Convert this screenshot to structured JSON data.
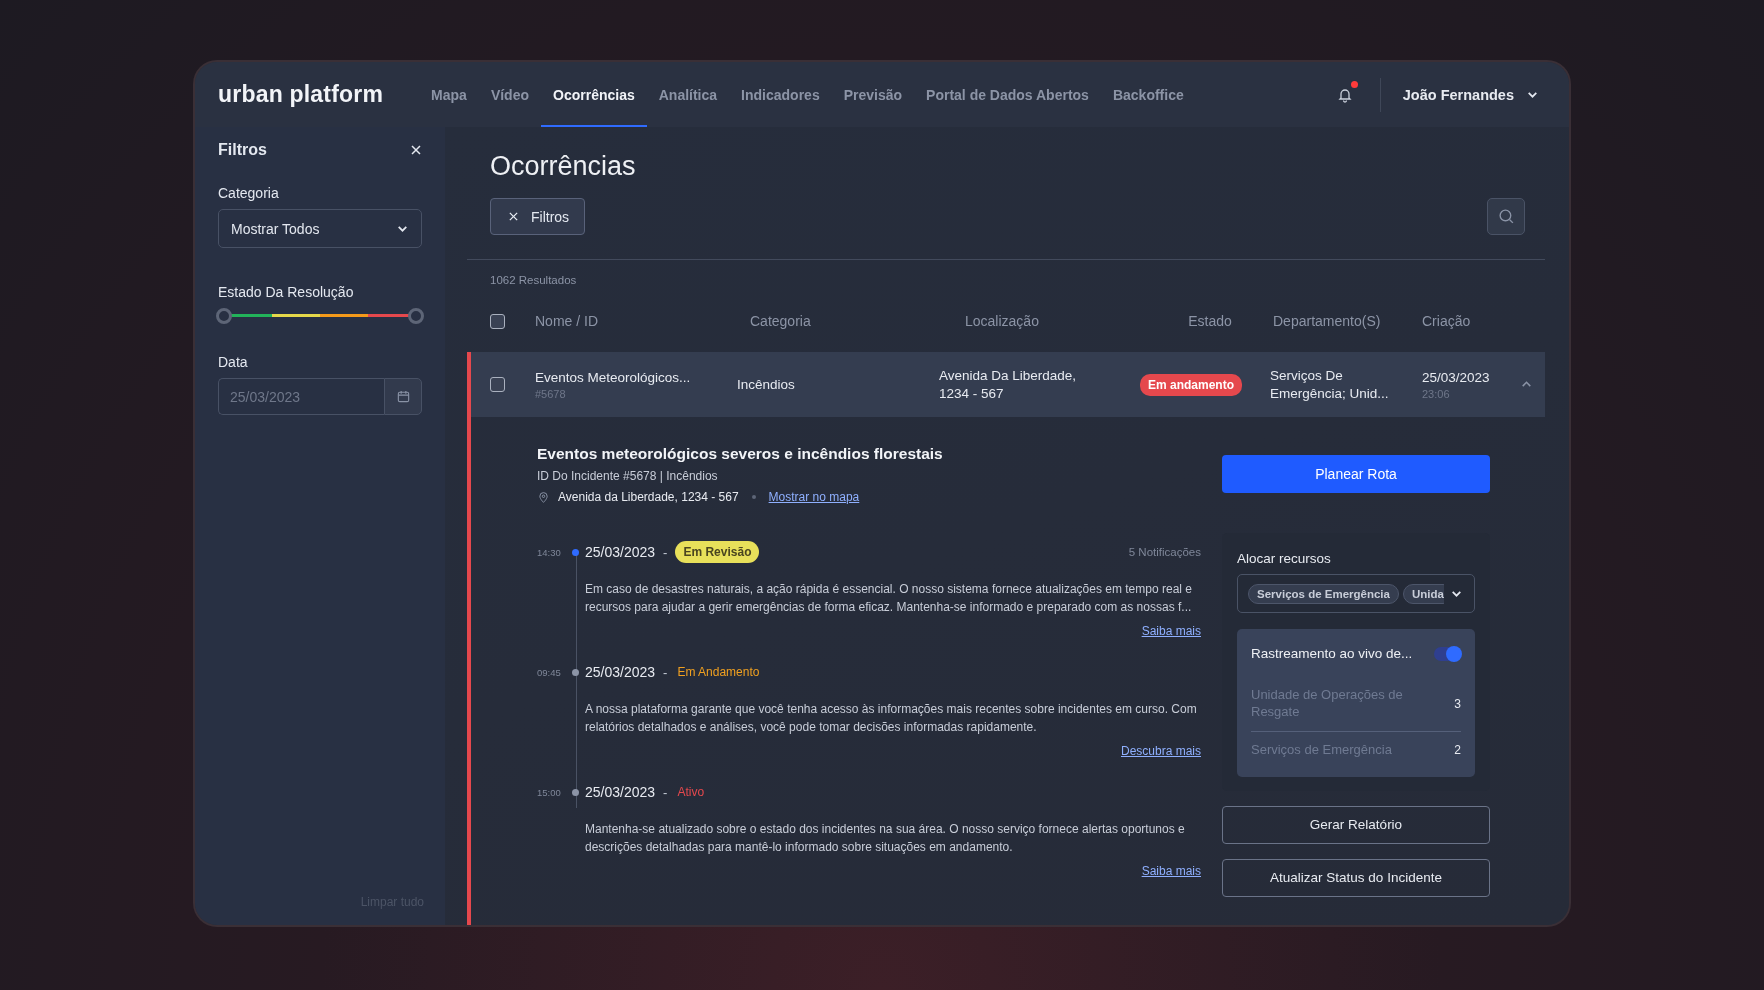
{
  "app": {
    "logo": "urban platform"
  },
  "nav": [
    {
      "label": "Mapa",
      "selected": false
    },
    {
      "label": "Vídeo",
      "selected": false
    },
    {
      "label": "Ocorrências",
      "selected": true
    },
    {
      "label": "Analítica",
      "selected": false
    },
    {
      "label": "Indicadores",
      "selected": false
    },
    {
      "label": "Previsão",
      "selected": false
    },
    {
      "label": "Portal de Dados Abertos",
      "selected": false
    },
    {
      "label": "Backoffice",
      "selected": false
    }
  ],
  "notifications": {
    "unread": true
  },
  "user": {
    "name": "João Fernandes"
  },
  "filters": {
    "title": "Filtros",
    "category_label": "Categoria",
    "category_value": "Mostrar Todos",
    "resolution_label": "Estado Da Resolução",
    "resolution_range": [
      {
        "level": 0
      },
      {
        "level": 1
      }
    ],
    "date_label": "Data",
    "date_placeholder": "25/03/2023",
    "clear": "Limpar tudo"
  },
  "page": {
    "title": "Ocorrências",
    "filters_button": "Filtros",
    "results": "1062 Resultados"
  },
  "table": {
    "select_all": {
      "checked": false
    },
    "columns": [
      "Nome / ID",
      "Categoria",
      "Localização",
      "Estado",
      "Departamento(S)",
      "Criação"
    ],
    "rows": [
      {
        "checked": false,
        "expanded": true,
        "name": "Eventos Meteorológicos...",
        "id": "#5678",
        "category": "Incêndios",
        "location": "Avenida Da Liberdade, 1234 - 567",
        "status": "Em andamento",
        "department": "Serviços De Emergência; Unid...",
        "date": "25/03/2023",
        "time": "23:06"
      }
    ]
  },
  "detail": {
    "title": "Eventos meteorológicos severos e incêndios florestais",
    "subtitle": "ID Do Incidente #5678 | Incêndios",
    "address": "Avenida da Liberdade, 1234 - 567",
    "map_link": "Mostrar no mapa",
    "timeline": [
      {
        "time": "14:30",
        "date": "25/03/2023",
        "separator": "-",
        "active": true,
        "status": {
          "kind": "badge",
          "label": "Em Revisão",
          "color": "#e8e05a"
        },
        "notifications": "5 Notificações",
        "text": "Em caso de desastres naturais, a ação rápida é essencial. O nosso sistema fornece atualizações em tempo real e recursos para ajudar a gerir emergências de forma eficaz. Mantenha-se informado e preparado com as nossas f...",
        "link": "Saiba mais"
      },
      {
        "time": "09:45",
        "date": "25/03/2023",
        "separator": "-",
        "active": false,
        "status": {
          "kind": "text",
          "label": "Em Andamento",
          "color": "#f0a020"
        },
        "text": "A nossa plataforma garante que você tenha acesso às informações mais recentes sobre incidentes em curso. Com relatórios detalhados e análises, você pode tomar decisões informadas rapidamente.",
        "link": "Descubra mais"
      },
      {
        "time": "15:00",
        "date": "25/03/2023",
        "separator": "-",
        "active": false,
        "status": {
          "kind": "text",
          "label": "Ativo",
          "color": "#e5484d"
        },
        "text": "Mantenha-se atualizado sobre o estado dos incidentes na sua área. O nosso serviço fornece alertas oportunos e descrições detalhadas para mantê-lo informado sobre situações em andamento.",
        "link": "Saiba mais"
      }
    ],
    "plan_route": "Planear Rota",
    "resources": {
      "title": "Alocar recursos",
      "tags": [
        "Serviços de Emergência",
        "Unida"
      ],
      "tracking": {
        "label": "Rastreamento ao vivo de...",
        "on": true
      },
      "units": [
        {
          "name": "Unidade de Operações de Resgate",
          "count": "3"
        },
        {
          "name": "Serviços de Emergência",
          "count": "2"
        }
      ]
    },
    "buttons": [
      "Gerar Relatório",
      "Atualizar Status do Incidente"
    ]
  }
}
